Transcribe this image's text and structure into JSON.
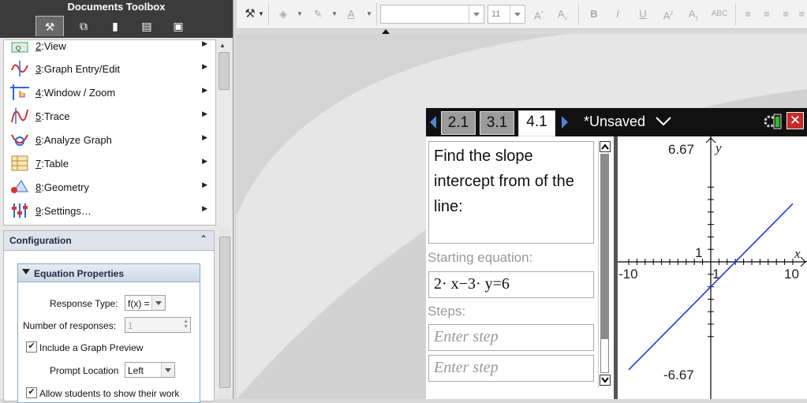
{
  "toolbox": {
    "title": "Documents Toolbox",
    "tabs": [
      {
        "icon": "tools-icon",
        "glyph": "⚒",
        "active": true
      },
      {
        "icon": "page-sorter-icon",
        "glyph": "⧉",
        "active": false
      },
      {
        "icon": "emulator-icon",
        "glyph": "▮",
        "active": false
      },
      {
        "icon": "content-explorer-icon",
        "glyph": "▤",
        "active": false
      },
      {
        "icon": "utilities-icon",
        "glyph": "▣",
        "active": false
      }
    ],
    "menu": [
      {
        "num": "2",
        "label": ":View",
        "icon": "view-icon"
      },
      {
        "num": "3",
        "label": ":Graph Entry/Edit",
        "icon": "graph-entry-icon"
      },
      {
        "num": "4",
        "label": ":Window / Zoom",
        "icon": "window-zoom-icon"
      },
      {
        "num": "5",
        "label": ":Trace",
        "icon": "trace-icon"
      },
      {
        "num": "6",
        "label": ":Analyze Graph",
        "icon": "analyze-graph-icon"
      },
      {
        "num": "7",
        "label": ":Table",
        "icon": "table-icon"
      },
      {
        "num": "8",
        "label": ":Geometry",
        "icon": "geometry-icon"
      },
      {
        "num": "9",
        "label": ":Settings…",
        "icon": "settings-icon"
      }
    ],
    "config": {
      "title": "Configuration",
      "section": "Equation Properties",
      "response_type_label": "Response Type:",
      "response_type_value": "f(x) =",
      "num_responses_label": "Number of responses:",
      "num_responses_value": "1",
      "include_graph_label": "Include a Graph Preview",
      "include_graph_checked": true,
      "prompt_location_label": "Prompt Location",
      "prompt_location_value": "Left",
      "allow_work_label": "Allow students to show their work",
      "allow_work_checked": true
    }
  },
  "format_toolbar": {
    "font_name": "",
    "font_size": "11",
    "buttons": [
      "A^",
      "A_v",
      "B",
      "I",
      "U",
      "A²",
      "A₁",
      "ABC"
    ]
  },
  "calculator": {
    "tabs": [
      "2.1",
      "3.1",
      "4.1"
    ],
    "active_tab": "4.1",
    "doc_title": "*Unsaved",
    "prompt": "Find the slope intercept from of the line:",
    "starting_label": "Starting equation:",
    "starting_equation": "2· x−3· y=6",
    "steps_label": "Steps:",
    "step_placeholder_1": "Enter step",
    "step_placeholder_2": "Enter step",
    "graph": {
      "ymax_label": "6.67",
      "ymin_label": "-6.67",
      "xmin_label": "-10",
      "xmax_label": "10",
      "xtick_label": "1",
      "ytick_label": "1",
      "xaxis_label": "x",
      "yaxis_label": "y",
      "xlim": [
        -10,
        10
      ],
      "ylim": [
        -6.67,
        6.67
      ],
      "line": {
        "slope": 0.6667,
        "intercept": -2
      },
      "line_color": "#1f3bd6"
    }
  }
}
